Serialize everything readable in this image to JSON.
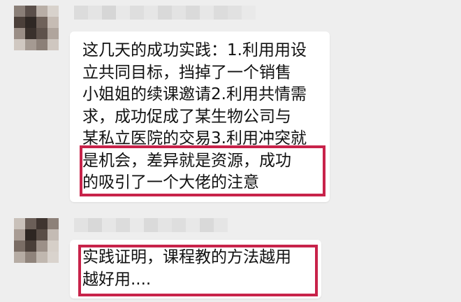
{
  "messages": [
    {
      "lines": [
        "这几天的成功实践：1.利用用设",
        "立共同目标，挡掉了一个销售",
        "小姐姐的续课邀请2.利用共情需",
        "求，成功促成了某生物公司与",
        "某私立医院的交易3.利用冲突就",
        "是机会，差异就是资源，成功",
        "的吸引了一个大佬的注意"
      ]
    },
    {
      "lines": [
        "实践证明，课程教的方法越用",
        "越好用...."
      ]
    }
  ],
  "colors": {
    "background": "#eeeeee",
    "bubble": "#ffffff",
    "highlight": "#c8234a",
    "text": "#111111"
  }
}
